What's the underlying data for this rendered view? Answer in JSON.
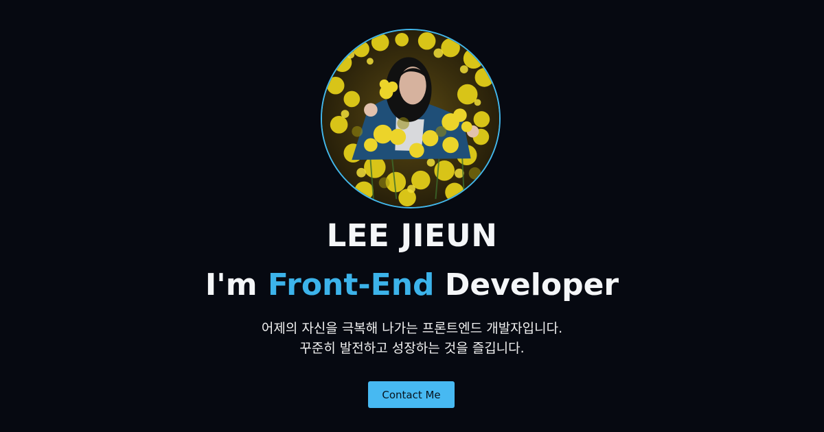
{
  "profile": {
    "name": "LEE JIEUN",
    "headline_prefix": "I'm ",
    "headline_accent": "Front-End",
    "headline_suffix": " Developer",
    "bio_line_1": "어제의 자신을 극복해 나가는 프론트엔드 개발자입니다.",
    "bio_line_2": "꾸준히 발전하고 성장하는 것을 즐깁니다.",
    "avatar_alt": "profile-photo"
  },
  "actions": {
    "contact_label": "Contact Me"
  },
  "colors": {
    "background": "#060911",
    "accent": "#3cb3ea",
    "button": "#47b9f2",
    "text": "#f4f6f8"
  }
}
